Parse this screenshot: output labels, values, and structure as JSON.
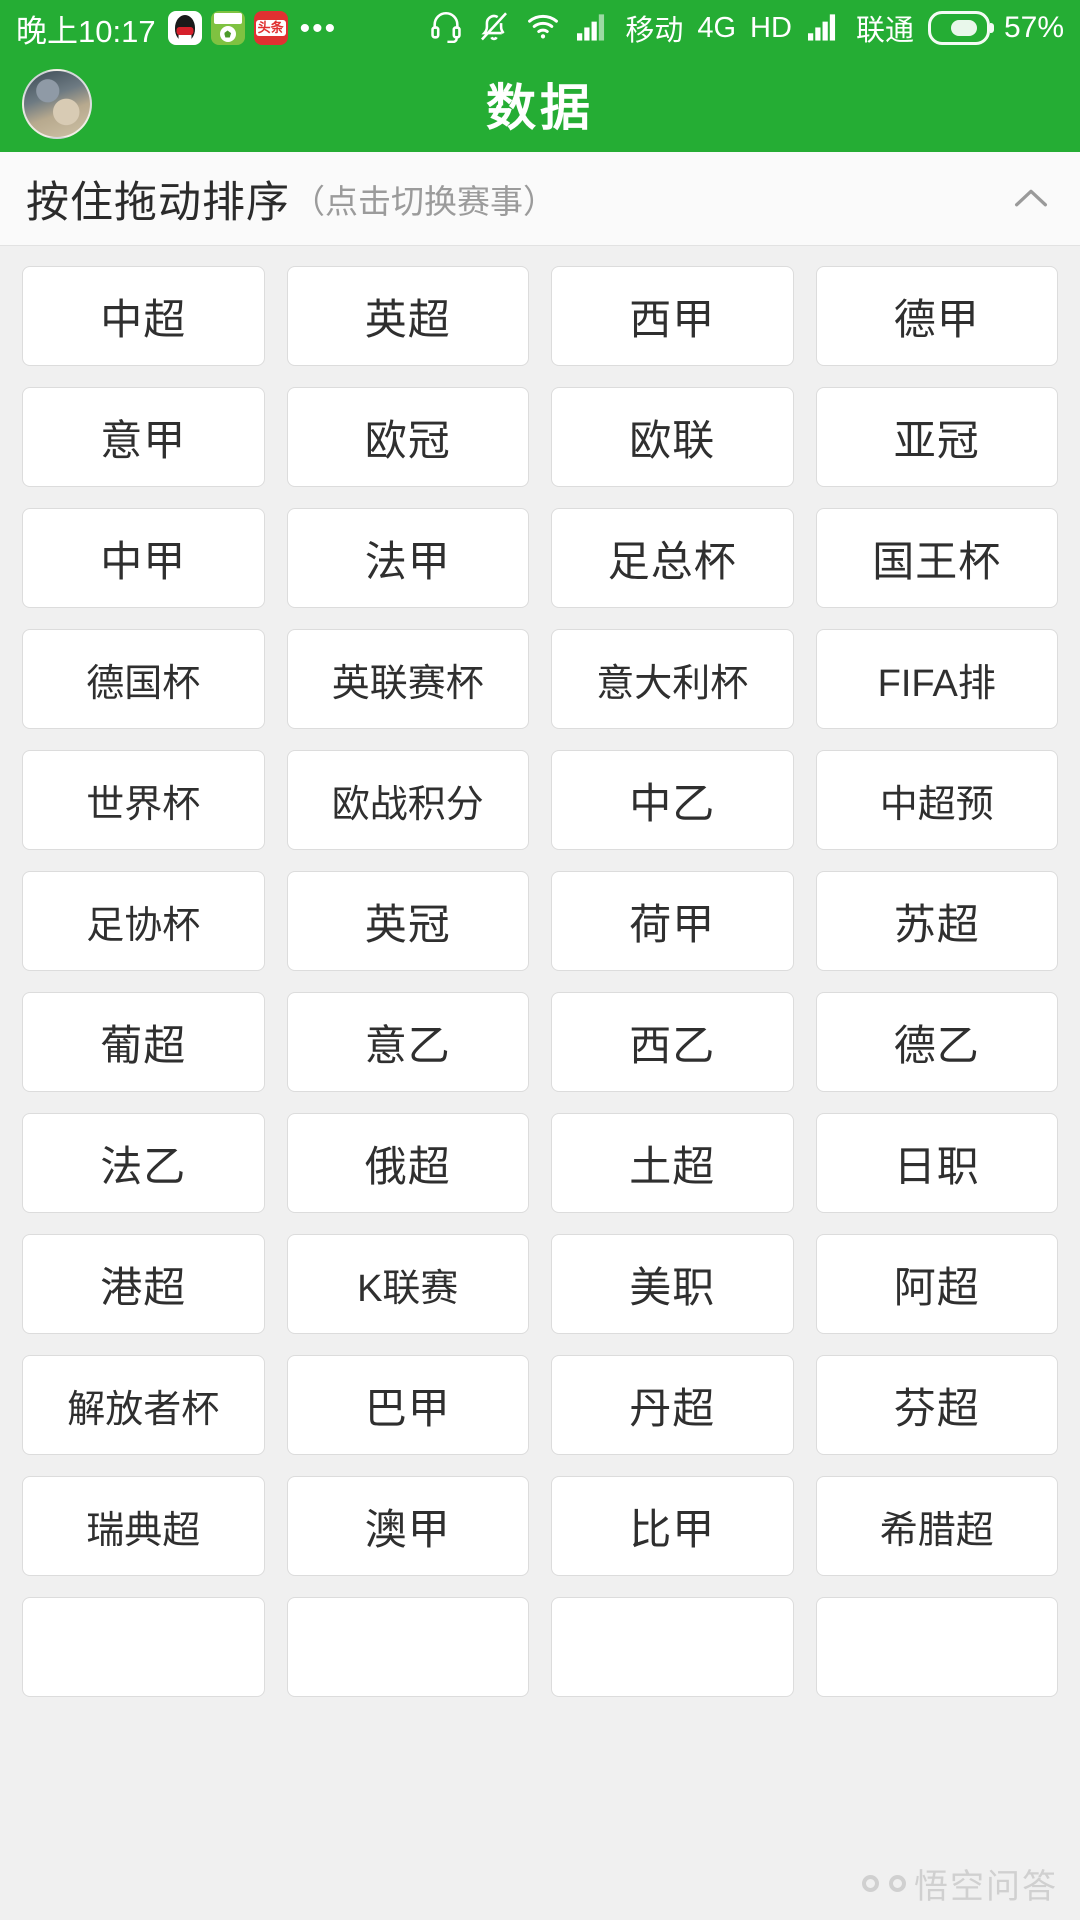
{
  "status_bar": {
    "time": "晚上10:17",
    "app_icons": [
      "qq-icon",
      "football-app-icon",
      "toutiao-icon"
    ],
    "toutiao_label": "头条",
    "overflow_dots": "•••",
    "icons": [
      "headset-icon",
      "bell-muted-icon",
      "wifi-icon",
      "signal-bars-icon"
    ],
    "carrier_1": "移动",
    "network_type": "4G",
    "hd_label": "HD",
    "carrier_2": "联通",
    "battery_percent": "57%"
  },
  "header": {
    "title": "数据",
    "avatar": "user-avatar"
  },
  "sort_bar": {
    "main_label": "按住拖动排序",
    "sub_label": "（点击切换赛事）",
    "collapse_icon": "chevron-up-icon"
  },
  "leagues": {
    "rows": [
      [
        "中超",
        "英超",
        "西甲",
        "德甲"
      ],
      [
        "意甲",
        "欧冠",
        "欧联",
        "亚冠"
      ],
      [
        "中甲",
        "法甲",
        "足总杯",
        "国王杯"
      ],
      [
        "德国杯",
        "英联赛杯",
        "意大利杯",
        "FIFA排"
      ],
      [
        "世界杯",
        "欧战积分",
        "中乙",
        "中超预"
      ],
      [
        "足协杯",
        "英冠",
        "荷甲",
        "苏超"
      ],
      [
        "葡超",
        "意乙",
        "西乙",
        "德乙"
      ],
      [
        "法乙",
        "俄超",
        "土超",
        "日职"
      ],
      [
        "港超",
        "K联赛",
        "美职",
        "阿超"
      ],
      [
        "解放者杯",
        "巴甲",
        "丹超",
        "芬超"
      ],
      [
        "瑞典超",
        "澳甲",
        "比甲",
        "希腊超"
      ],
      [
        "",
        "",
        "",
        ""
      ]
    ]
  },
  "watermark": {
    "text": "悟空问答"
  },
  "colors": {
    "brand_green": "#25ad34",
    "page_background": "#f0f0f0",
    "chip_background": "#ffffff",
    "chip_border": "#dcdcdc",
    "text_primary": "#2f2f2f",
    "text_muted": "#9b9b9b"
  }
}
